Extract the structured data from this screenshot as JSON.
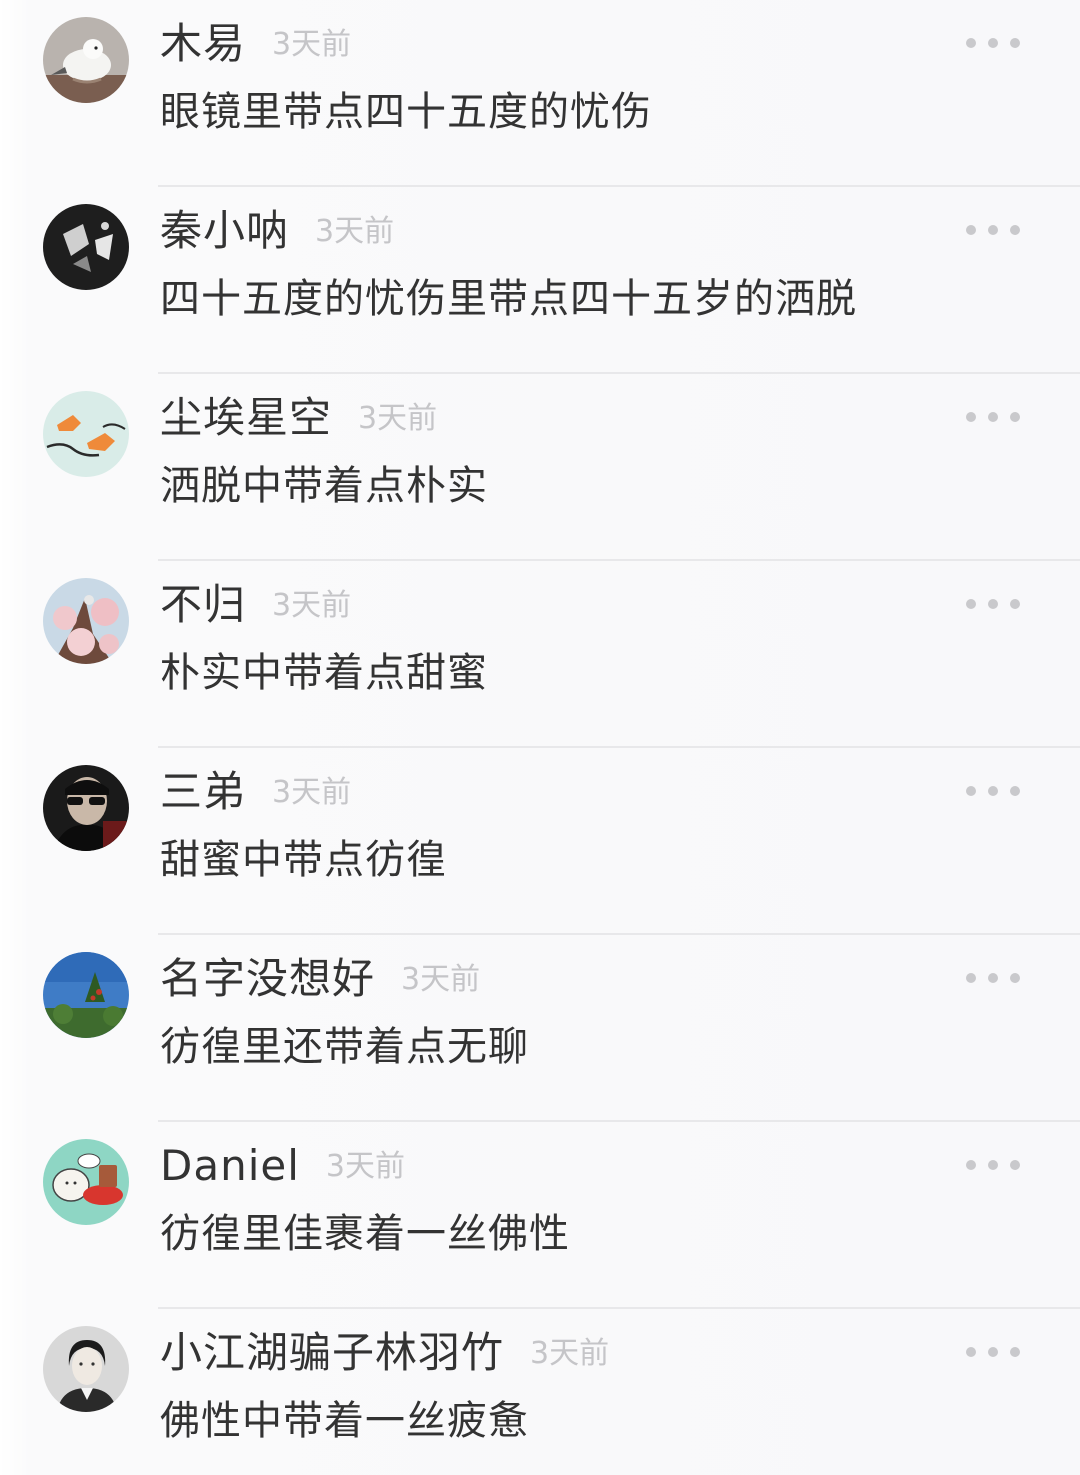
{
  "comments": [
    {
      "username": "木易",
      "time": "3天前",
      "text": "眼镜里带点四十五度的忧伤",
      "avatar_icon": "bird-avatar"
    },
    {
      "username": "秦小呐",
      "time": "3天前",
      "text": "四十五度的忧伤里带点四十五岁的洒脱",
      "avatar_icon": "dark-photo-avatar"
    },
    {
      "username": "尘埃星空",
      "time": "3天前",
      "text": "洒脱中带着点朴实",
      "avatar_icon": "fox-avatar"
    },
    {
      "username": "不归",
      "time": "3天前",
      "text": "朴实中带着点甜蜜",
      "avatar_icon": "blossom-avatar"
    },
    {
      "username": "三弟",
      "time": "3天前",
      "text": "甜蜜中带点彷徨",
      "avatar_icon": "sunglasses-person-avatar"
    },
    {
      "username": "名字没想好",
      "time": "3天前",
      "text": "彷徨里还带着点无聊",
      "avatar_icon": "sky-tree-avatar"
    },
    {
      "username": "Daniel",
      "time": "3天前",
      "text": "彷徨里佳裹着一丝佛性",
      "avatar_icon": "cartoon-avatar"
    },
    {
      "username": "小江湖骗子林羽竹",
      "time": "3天前",
      "text": "佛性中带着一丝疲惫",
      "avatar_icon": "portrait-sketch-avatar"
    }
  ],
  "colors": {
    "text": "#333333",
    "timestamp": "#c5c5c8",
    "divider": "#e8e8ea",
    "dots": "#c9c9cc"
  }
}
